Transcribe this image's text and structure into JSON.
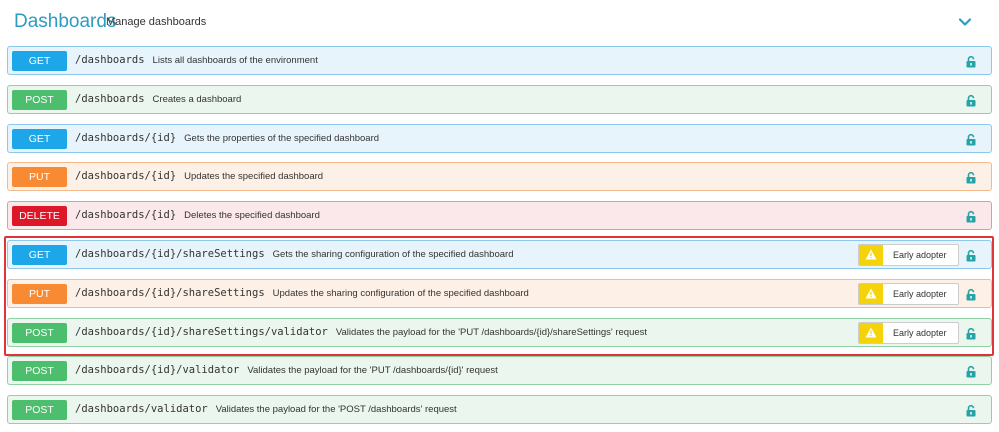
{
  "header": {
    "title": "Dashboards",
    "subtitle": "Manage dashboards"
  },
  "badge_label": "Early adopter",
  "endpoints": [
    {
      "method": "GET",
      "path": "/dashboards",
      "description": "Lists all dashboards of the environment"
    },
    {
      "method": "POST",
      "path": "/dashboards",
      "description": "Creates a dashboard"
    },
    {
      "method": "GET",
      "path": "/dashboards/{id}",
      "description": "Gets the properties of the specified dashboard"
    },
    {
      "method": "PUT",
      "path": "/dashboards/{id}",
      "description": "Updates the specified dashboard"
    },
    {
      "method": "DELETE",
      "path": "/dashboards/{id}",
      "description": "Deletes the specified dashboard"
    },
    {
      "method": "GET",
      "path": "/dashboards/{id}/shareSettings",
      "description": "Gets the sharing configuration of the specified dashboard"
    },
    {
      "method": "PUT",
      "path": "/dashboards/{id}/shareSettings",
      "description": "Updates the sharing configuration of the specified dashboard"
    },
    {
      "method": "POST",
      "path": "/dashboards/{id}/shareSettings/validator",
      "description": "Validates the payload for the 'PUT /dashboards/{id}/shareSettings' request"
    },
    {
      "method": "POST",
      "path": "/dashboards/{id}/validator",
      "description": "Validates the payload for the 'PUT /dashboards/{id}' request"
    },
    {
      "method": "POST",
      "path": "/dashboards/validator",
      "description": "Validates the payload for the 'POST /dashboards' request"
    }
  ],
  "early_adopter_rows": [
    5,
    6,
    7
  ],
  "colors": {
    "title": "#2d9cbf",
    "get": "#1ea7e8",
    "post": "#4dbd6e",
    "put": "#f88a34",
    "delete": "#dc172a",
    "highlight": "#e0343b",
    "lock": "#26a3a6",
    "warning": "#f5d30a"
  },
  "icons": {
    "expand": "chevron-down-icon",
    "lock": "lock-icon",
    "warning": "warning-icon"
  }
}
